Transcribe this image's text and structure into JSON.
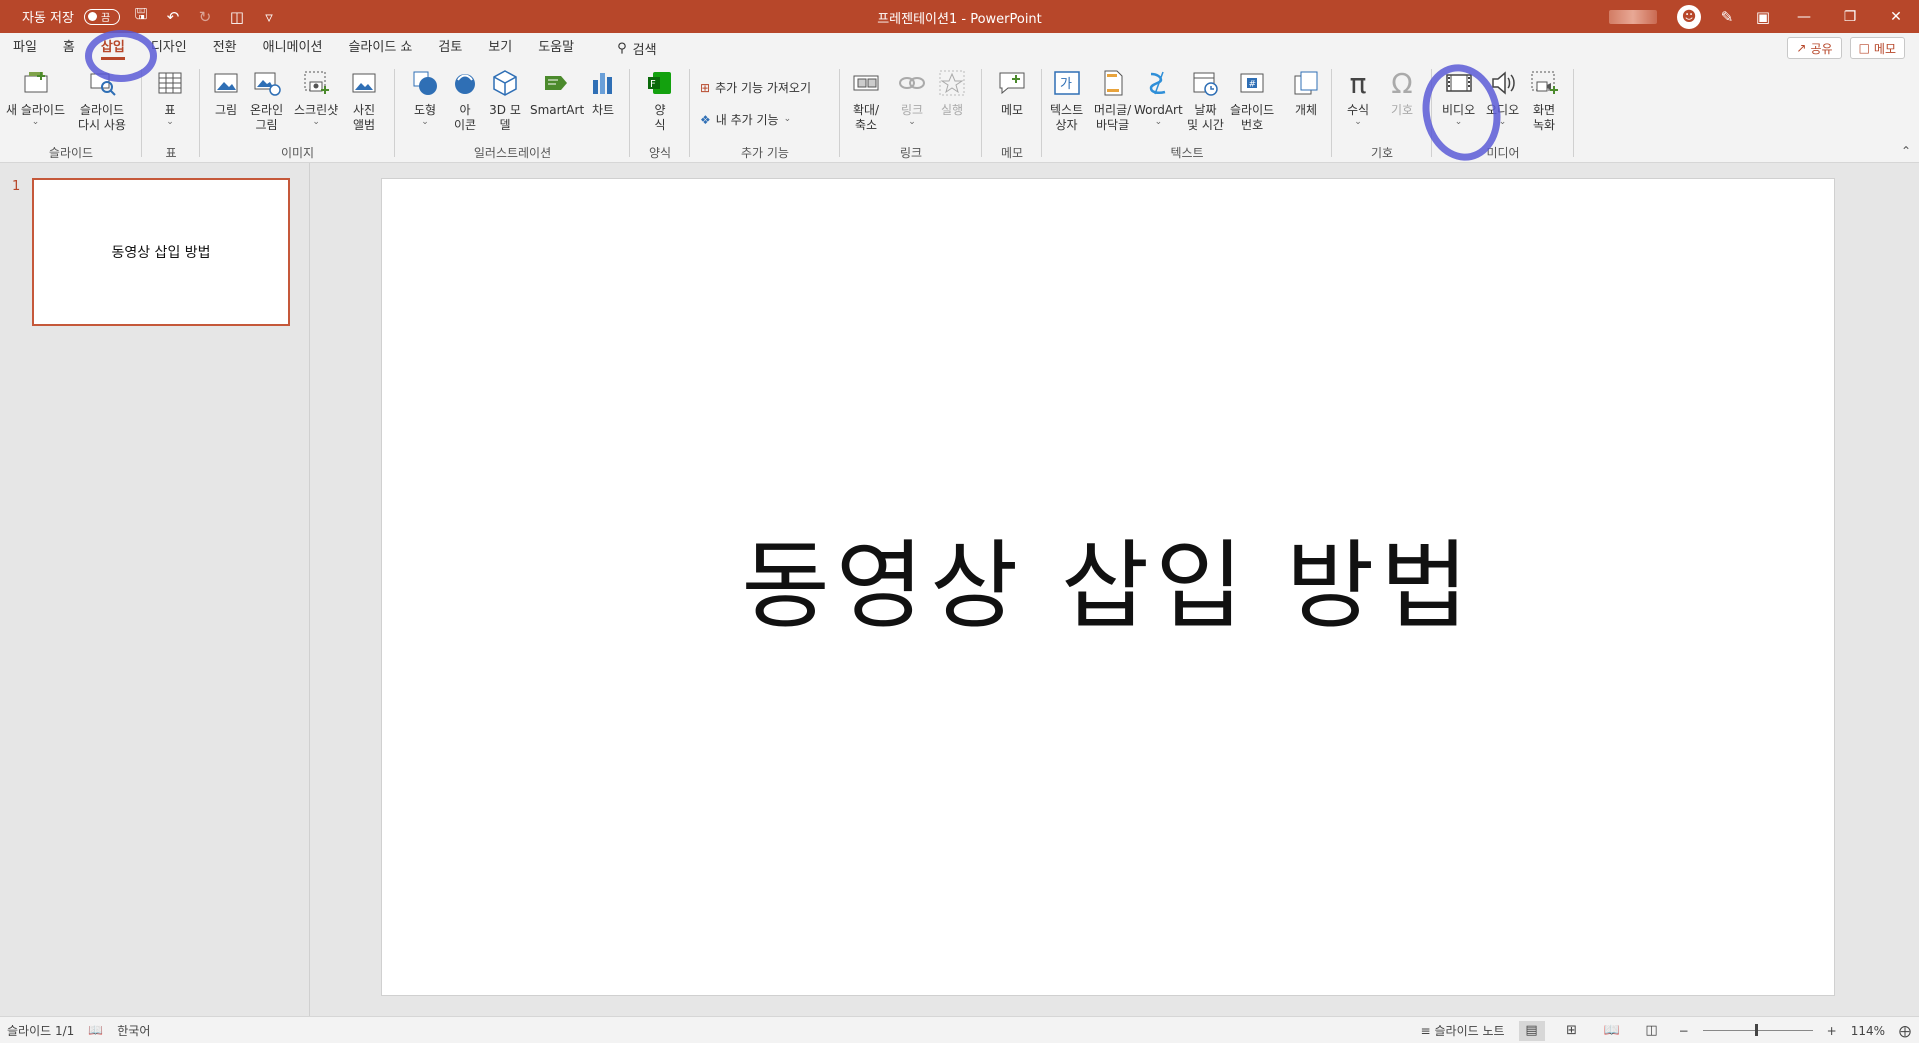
{
  "titlebar": {
    "autosave_label": "자동 저장",
    "autosave_state": "끔",
    "document_title": "프레젠테이션1  -  PowerPoint"
  },
  "tabs": [
    {
      "label": "파일"
    },
    {
      "label": "홈"
    },
    {
      "label": "삽입",
      "active": true
    },
    {
      "label": "디자인"
    },
    {
      "label": "전환"
    },
    {
      "label": "애니메이션"
    },
    {
      "label": "슬라이드 쇼"
    },
    {
      "label": "검토"
    },
    {
      "label": "보기"
    },
    {
      "label": "도움말"
    }
  ],
  "search": {
    "label": "검색"
  },
  "share": {
    "label": "공유"
  },
  "comments": {
    "label": "메모"
  },
  "ribbon": {
    "groups": {
      "slides": "슬라이드",
      "table": "표",
      "images": "이미지",
      "illustrations": "일러스트레이션",
      "forms": "양식",
      "addins": "추가 기능",
      "links": "링크",
      "comments": "메모",
      "text": "텍스트",
      "symbols": "기호",
      "media": "미디어"
    },
    "buttons": {
      "new_slide": [
        "새 슬라이드"
      ],
      "reuse_slides": [
        "슬라이드",
        "다시 사용"
      ],
      "table": [
        "표"
      ],
      "pictures": [
        "그림"
      ],
      "online_pictures": [
        "온라인",
        "그림"
      ],
      "screenshot": [
        "스크린샷"
      ],
      "photo_album": [
        "사진",
        "앨범"
      ],
      "shapes": [
        "도형"
      ],
      "icons": [
        "아",
        "이콘"
      ],
      "models_3d": [
        "3D 모",
        "델"
      ],
      "smartart": [
        "SmartArt"
      ],
      "chart": [
        "차트"
      ],
      "forms": [
        "양",
        "식"
      ],
      "get_addins": "추가 기능 가져오기",
      "my_addins": "내 추가 기능",
      "zoom": [
        "확대/",
        "축소"
      ],
      "link": [
        "링크"
      ],
      "action": [
        "실행"
      ],
      "comment": [
        "메모"
      ],
      "textbox": [
        "텍스트",
        "상자"
      ],
      "header_footer": [
        "머리글/",
        "바닥글"
      ],
      "wordart": [
        "WordArt"
      ],
      "date_time": [
        "날짜",
        "및 시간"
      ],
      "slide_number": [
        "슬라이드",
        "번호"
      ],
      "object": [
        "개체"
      ],
      "equation": [
        "수식"
      ],
      "symbol": [
        "기호"
      ],
      "video": [
        "비디오"
      ],
      "audio": [
        "오디오"
      ],
      "screen_recording": [
        "화면",
        "녹화"
      ]
    }
  },
  "slides_pane": {
    "number": "1",
    "thumb_title": "동영상 삽입 방법"
  },
  "slide": {
    "title": "동영상 삽입 방법"
  },
  "statusbar": {
    "slide_info": "슬라이드 1/1",
    "language": "한국어",
    "notes": "슬라이드 노트",
    "zoom": "114%"
  },
  "colors": {
    "accent": "#b7472a",
    "annotation": "#5b5bd6"
  }
}
